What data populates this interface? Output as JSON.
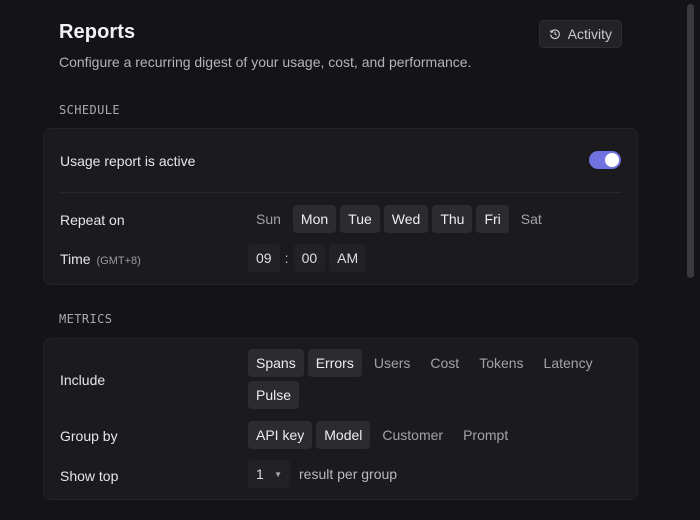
{
  "header": {
    "title": "Reports",
    "subtitle": "Configure a recurring digest of your usage, cost, and performance.",
    "activity_label": "Activity",
    "activity_icon": "history-icon"
  },
  "schedule": {
    "section_label": "SCHEDULE",
    "active_label": "Usage report is active",
    "active": true,
    "repeat_label": "Repeat on",
    "days": [
      {
        "label": "Sun",
        "selected": false
      },
      {
        "label": "Mon",
        "selected": true
      },
      {
        "label": "Tue",
        "selected": true
      },
      {
        "label": "Wed",
        "selected": true
      },
      {
        "label": "Thu",
        "selected": true
      },
      {
        "label": "Fri",
        "selected": true
      },
      {
        "label": "Sat",
        "selected": false
      }
    ],
    "time_label": "Time",
    "timezone": "(GMT+8)",
    "hour": "09",
    "separator": ":",
    "minute": "00",
    "ampm": "AM"
  },
  "metrics": {
    "section_label": "METRICS",
    "include_label": "Include",
    "include": [
      {
        "label": "Spans",
        "selected": true
      },
      {
        "label": "Errors",
        "selected": true
      },
      {
        "label": "Users",
        "selected": false
      },
      {
        "label": "Cost",
        "selected": false
      },
      {
        "label": "Tokens",
        "selected": false
      },
      {
        "label": "Latency",
        "selected": false
      },
      {
        "label": "Pulse",
        "selected": true
      }
    ],
    "group_label": "Group by",
    "group_by": [
      {
        "label": "API key",
        "selected": true
      },
      {
        "label": "Model",
        "selected": true
      },
      {
        "label": "Customer",
        "selected": false
      },
      {
        "label": "Prompt",
        "selected": false
      }
    ],
    "show_top_label": "Show top",
    "show_top_value": "1",
    "show_top_suffix": "result per group"
  },
  "colors": {
    "background": "#141416",
    "card": "#1b1b1e",
    "accent": "#6f72e0",
    "chip_selected": "#2b2b30"
  }
}
